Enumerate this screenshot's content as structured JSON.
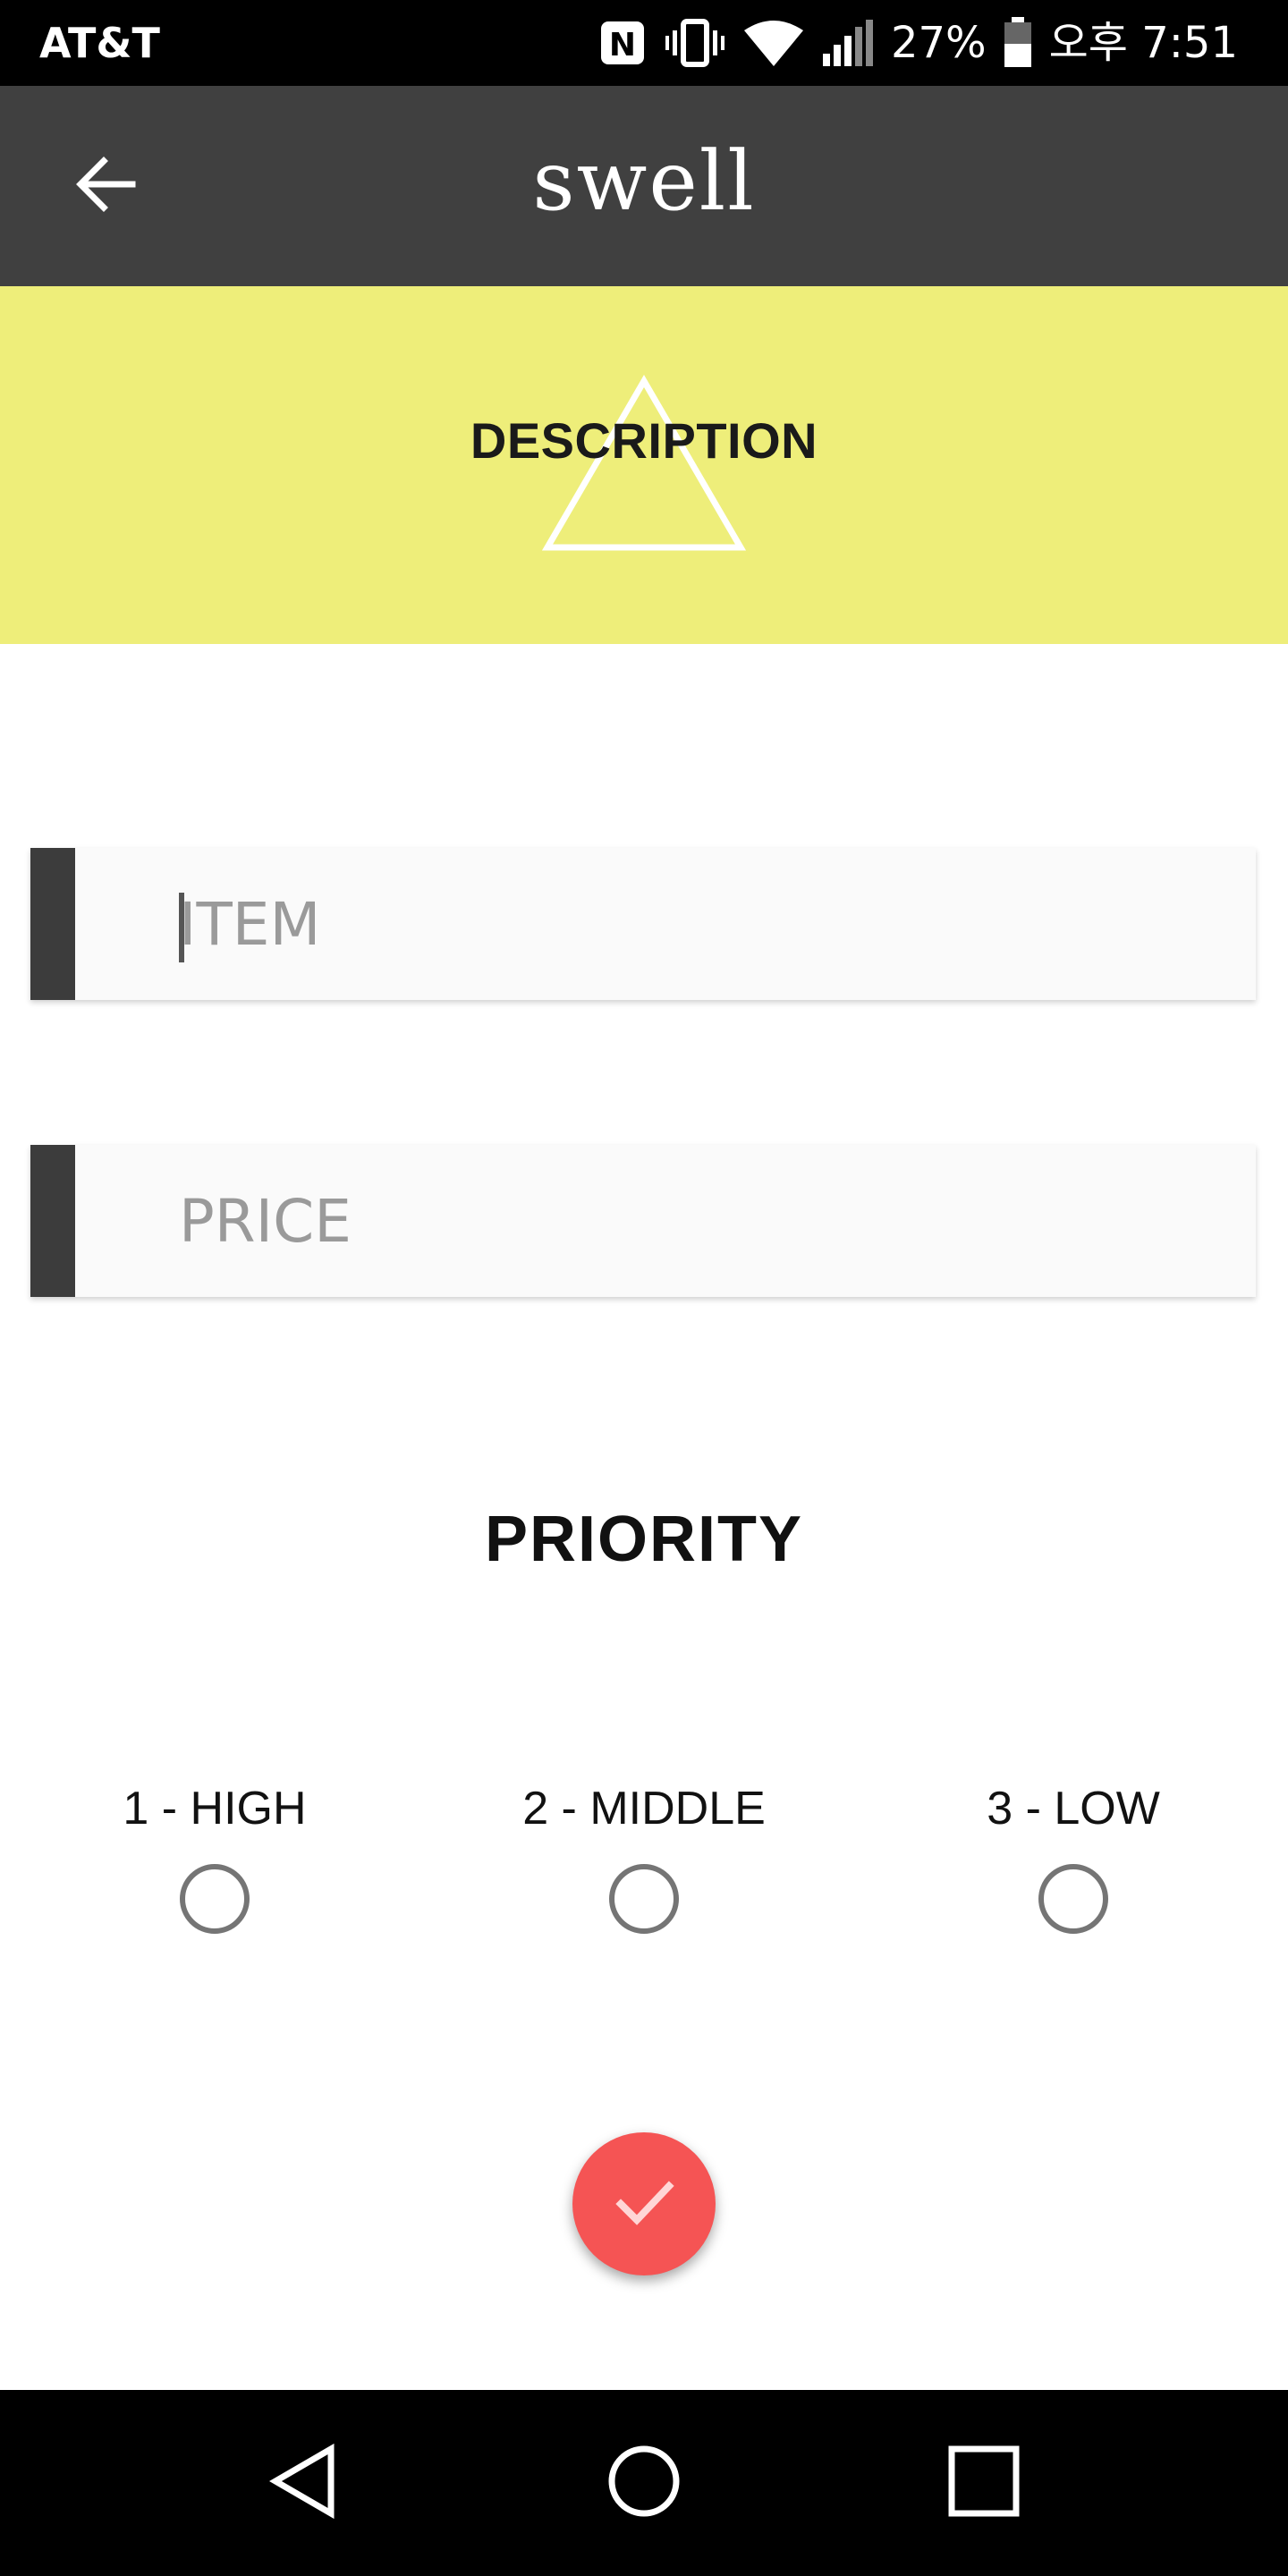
{
  "status_bar": {
    "carrier": "AT&T",
    "battery_percent": "27%",
    "time": "오후 7:51",
    "icons": [
      "nfc-icon",
      "vibrate-icon",
      "wifi-icon",
      "signal-icon",
      "battery-icon"
    ]
  },
  "app_bar": {
    "title": "swell",
    "back_icon": "arrow-left-icon"
  },
  "banner": {
    "title": "DESCRIPTION",
    "background_color": "#eeee7a",
    "icon": "triangle-outline-icon"
  },
  "form": {
    "item_placeholder": "ITEM",
    "item_value": "",
    "price_placeholder": "PRICE",
    "price_value": ""
  },
  "priority": {
    "title": "PRIORITY",
    "options": [
      {
        "label": "1 - HIGH",
        "selected": false
      },
      {
        "label": "2 - MIDDLE",
        "selected": false
      },
      {
        "label": "3 - LOW",
        "selected": false
      }
    ]
  },
  "fab": {
    "icon": "check-icon",
    "color": "#f55454"
  },
  "nav_bar": {
    "icons": [
      "nav-back-icon",
      "nav-home-icon",
      "nav-recents-icon"
    ]
  }
}
